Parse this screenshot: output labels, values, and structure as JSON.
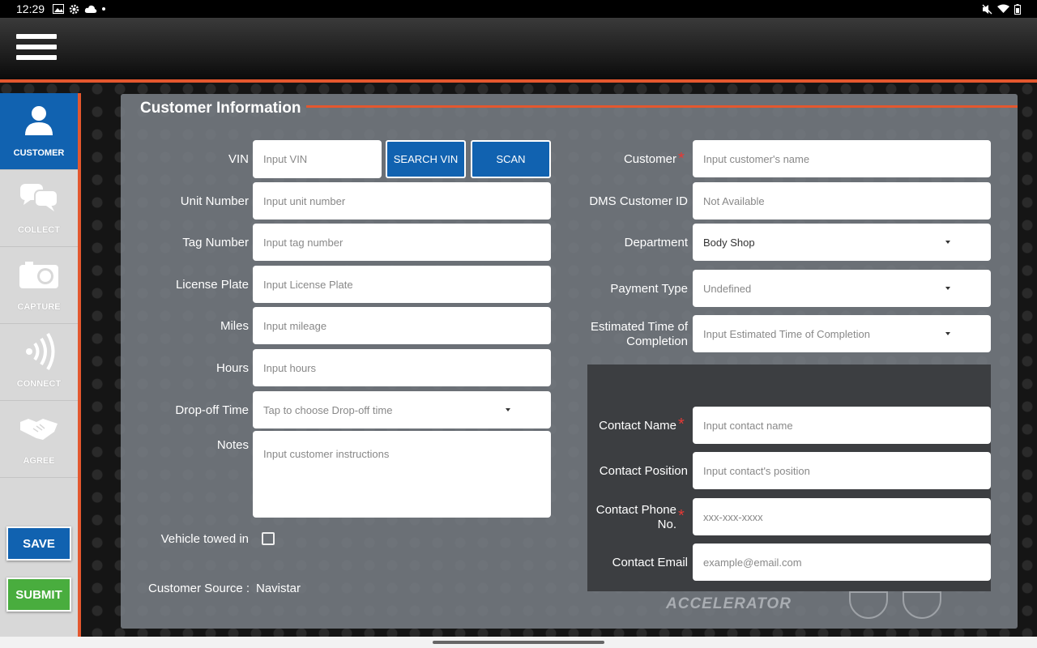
{
  "status_bar": {
    "time": "12:29"
  },
  "nav": {
    "items": [
      {
        "label": "CUSTOMER"
      },
      {
        "label": "COLLECT"
      },
      {
        "label": "CAPTURE"
      },
      {
        "label": "CONNECT"
      },
      {
        "label": "AGREE"
      }
    ],
    "save_label": "SAVE",
    "submit_label": "SUBMIT"
  },
  "section_title": "Customer Information",
  "vehicle": {
    "vin": {
      "label": "VIN",
      "placeholder": "Input VIN"
    },
    "search_vin_label": "SEARCH VIN",
    "scan_label": "SCAN",
    "unit_number": {
      "label": "Unit Number",
      "placeholder": "Input unit number"
    },
    "tag_number": {
      "label": "Tag Number",
      "placeholder": "Input tag number"
    },
    "license_plate": {
      "label": "License Plate",
      "placeholder": "Input License Plate"
    },
    "miles": {
      "label": "Miles",
      "placeholder": "Input mileage"
    },
    "hours": {
      "label": "Hours",
      "placeholder": "Input hours"
    },
    "dropoff_time": {
      "label": "Drop-off Time",
      "placeholder": "Tap to choose Drop-off time"
    },
    "notes": {
      "label": "Notes",
      "placeholder": "Input customer instructions"
    },
    "towed": {
      "label": "Vehicle towed in",
      "checked": false
    },
    "customer_source": {
      "label": "Customer Source :",
      "value": "Navistar"
    }
  },
  "customer": {
    "name": {
      "label": "Customer",
      "placeholder": "Input customer's name"
    },
    "dms_id": {
      "label": "DMS Customer ID",
      "value": "Not Available"
    },
    "department": {
      "label": "Department",
      "value": "Body Shop"
    },
    "payment_type": {
      "label": "Payment Type",
      "value": "Undefined"
    },
    "etc": {
      "label_line1": "Estimated Time of",
      "label_line2": "Completion",
      "placeholder": "Input Estimated Time of Completion"
    }
  },
  "contact": {
    "name": {
      "label": "Contact Name",
      "placeholder": "Input contact name"
    },
    "position": {
      "label": "Contact Position",
      "placeholder": "Input contact's position"
    },
    "phone": {
      "label_line1": "Contact Phone",
      "label_line2": "No.",
      "placeholder": "xxx-xxx-xxxx"
    },
    "email": {
      "label": "Contact Email",
      "placeholder": "example@email.com"
    }
  },
  "watermark": "ACCELERATOR",
  "colors": {
    "accent_orange": "#e4572e",
    "primary_blue": "#1162b0",
    "submit_green": "#49ad3e",
    "required_red": "#e53935"
  }
}
